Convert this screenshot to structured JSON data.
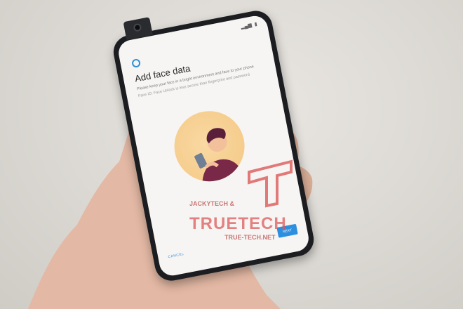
{
  "screen": {
    "title": "Add face data",
    "description_1": "Please keep your face in a bright environment and face to your phone",
    "description_2": "Face ID: Face Unlock is less secure than fingerprint and password",
    "next_label": "NEXT",
    "cancel_label": "CANCEL"
  },
  "watermark": {
    "line1": "JACKYTECH &",
    "brand": "TRUETECH",
    "url": "TRUE-TECH.NET"
  },
  "colors": {
    "accent": "#2d8fe0",
    "watermark": "#dc5a5a"
  }
}
